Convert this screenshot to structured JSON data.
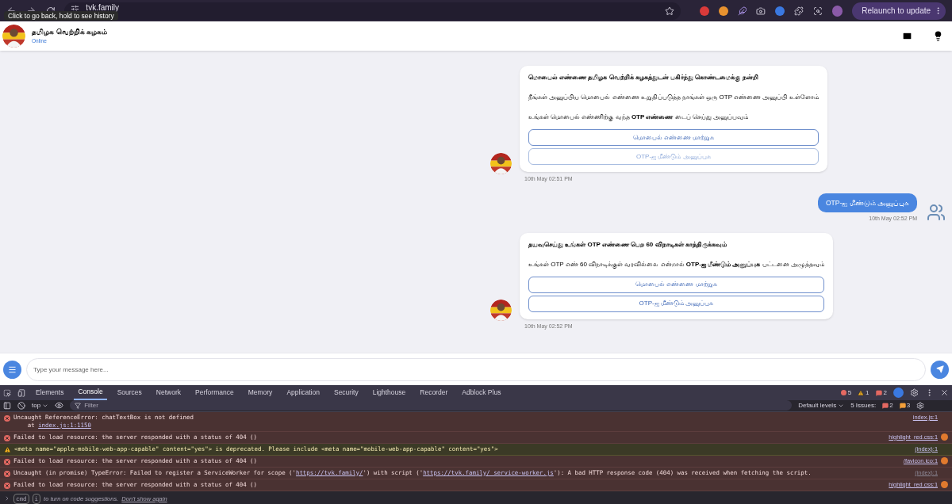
{
  "browser": {
    "url": "tvk.family",
    "tooltip": "Click to go back, hold to see history",
    "relaunch_button": "Relaunch to update"
  },
  "chat_header": {
    "name": "தமிழக வெற்றிக் கழகம்",
    "status": "Online"
  },
  "messages": [
    {
      "kind": "bot",
      "paragraphs": [
        "**மொபைல் எண்ணை தமிழக வெற்றிக் கழகத்துடன் பகிர்ந்து கொண்டமைக்கு நன்றி**",
        "நீங்கள் அனுப்பிய மொபைல் எண்ணை உறுதிப்படுத்த நாங்கள் ஒரு OTP எண்ணை அனுப்பி உள்ளோம்",
        "உங்கள் மொபைல் எண்ணிற்கு வந்த **OTP எண்ணை** டைப் செய்து அனுப்பவும்"
      ],
      "buttons": [
        {
          "label": "மொபைல் எண்ணை மாற்றுக",
          "disabled": false
        },
        {
          "label": "OTP-ஐ மீண்டும் அனுப்புக",
          "disabled": true
        }
      ],
      "time": "10th May 02:51 PM"
    },
    {
      "kind": "user",
      "text": "OTP-ஐ மீண்டும் அனுப்புக",
      "time": "10th May 02:52 PM"
    },
    {
      "kind": "bot",
      "paragraphs": [
        "**தயவுசெய்து உங்கள் OTP எண்ணை பெற 60 விநாடிகள் காத்திருக்கவும்**",
        "உங்கள் OTP எண் 60 விநாடிக்குள் வரவில்லை என்றால் **OTP-ஐ மீண்டும் அனுப்புக** பட்டனை அழுத்தவும்"
      ],
      "buttons": [
        {
          "label": "மொபைல் எண்ணை மாற்றுக",
          "disabled": false
        },
        {
          "label": "OTP-ஐ மீண்டும் அனுப்புக",
          "disabled": false
        }
      ],
      "time": "10th May 02:52 PM"
    }
  ],
  "composer": {
    "placeholder": "Type your message here..."
  },
  "devtools": {
    "tabs": [
      {
        "label": "Elements",
        "selected": false
      },
      {
        "label": "Console",
        "selected": true
      },
      {
        "label": "Sources",
        "selected": false
      },
      {
        "label": "Network",
        "selected": false
      },
      {
        "label": "Performance",
        "selected": false
      },
      {
        "label": "Memory",
        "selected": false
      },
      {
        "label": "Application",
        "selected": false
      },
      {
        "label": "Security",
        "selected": false
      },
      {
        "label": "Lighthouse",
        "selected": false
      },
      {
        "label": "Recorder",
        "selected": false
      },
      {
        "label": "Adblock Plus",
        "selected": false
      }
    ],
    "counts": {
      "errors": "5",
      "warnings": "1",
      "issues": "2"
    },
    "context": "top",
    "filter_placeholder": "Filter",
    "levels": "Default levels",
    "issues_label": "5 Issues:",
    "issues_errors": "2",
    "issues_warnings": "3",
    "rows": [
      {
        "kind": "error",
        "lines": [
          [
            {
              "kind": "text",
              "text": "Uncaught ReferenceError: chatTextBox is not defined"
            }
          ],
          [
            {
              "kind": "text",
              "text": "    at "
            },
            {
              "kind": "link",
              "text": "index.js:1:1150"
            }
          ]
        ],
        "source": "index.js:1",
        "dim": false,
        "override": false
      },
      {
        "kind": "error",
        "lines": [
          [
            {
              "kind": "text",
              "text": "Failed to load resource: the server responded with a status of 404 ()"
            }
          ]
        ],
        "source": "highlight_red.css:1",
        "dim": false,
        "override": true
      },
      {
        "kind": "warning",
        "lines": [
          [
            {
              "kind": "text",
              "text": "<meta name=\"apple-mobile-web-app-capable\" content=\"yes\"> is deprecated. Please include <meta name=\"mobile-web-app-capable\" content=\"yes\">"
            }
          ]
        ],
        "source": "(index):1",
        "dim": false,
        "override": false
      },
      {
        "kind": "error",
        "lines": [
          [
            {
              "kind": "text",
              "text": "Failed to load resource: the server responded with a status of 404 ()"
            }
          ]
        ],
        "source": "/favicon.ico:1",
        "dim": false,
        "override": true
      },
      {
        "kind": "error",
        "lines": [
          [
            {
              "kind": "text",
              "text": "Uncaught (in promise) TypeError: Failed to register a ServiceWorker for scope ('"
            },
            {
              "kind": "link",
              "text": "https://tvk.family/"
            },
            {
              "kind": "text",
              "text": "') with script ('"
            },
            {
              "kind": "link",
              "text": "https://tvk.family/_service-worker.js"
            },
            {
              "kind": "text",
              "text": "'): A bad HTTP response code (404) was received when fetching the script."
            }
          ]
        ],
        "source": "(index):1",
        "dim": true,
        "override": false
      },
      {
        "kind": "error",
        "lines": [
          [
            {
              "kind": "text",
              "text": "Failed to load resource: the server responded with a status of 404 ()"
            }
          ]
        ],
        "source": "highlight_red.css:1",
        "dim": false,
        "override": true
      }
    ],
    "prompt": {
      "key1": "cmd",
      "key2": "i",
      "hint": "to turn on code suggestions.",
      "dismiss": "Don't show again"
    }
  }
}
